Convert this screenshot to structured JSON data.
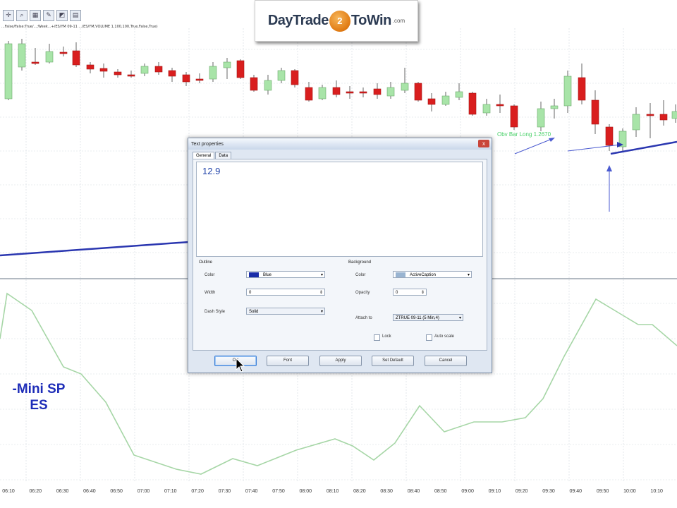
{
  "logo": {
    "left": "DayTrade",
    "badge": "2",
    "right": "ToWin",
    "com": ".com"
  },
  "chart_params": "...False/False:True/...;Week...+/ES/YM 09-11 ...(ES/YM,VOLUME 1,100,100,True,False,True)",
  "annotation_green": "Obv Bar Long 1.2670",
  "chart_label": {
    "line1": "-Mini SP",
    "line2": "ES"
  },
  "time_ticks": [
    "06:10",
    "06:20",
    "06:30",
    "06:40",
    "06:50",
    "07:00",
    "07:10",
    "07:20",
    "07:30",
    "07:40",
    "07:50",
    "08:00",
    "08:10",
    "08:20",
    "08:30",
    "08:40",
    "08:50",
    "09:00",
    "09:10",
    "09:20",
    "09:30",
    "09:40",
    "09:50",
    "10:00",
    "10:10"
  ],
  "dialog": {
    "title": "Text properties",
    "close": "x",
    "tabs": [
      "General",
      "Data"
    ],
    "text_value": "12.9",
    "outline": {
      "title": "Outline",
      "color_label": "Color",
      "color_value": "Blue",
      "color_hex": "#1a2da8",
      "width_label": "Width",
      "width_value": "0",
      "dash_label": "Dash Style",
      "dash_value": "Solid"
    },
    "background": {
      "title": "Background",
      "color_label": "Color",
      "color_value": "ActiveCaption",
      "color_hex": "#99b4d1",
      "opacity_label": "Opacity",
      "opacity_value": "0",
      "attach_label": "Attach to",
      "attach_value": "ZTRUE 09-11 (5 Min,4)",
      "lock_label": "Lock",
      "autoscale_label": "Auto scale"
    },
    "buttons": {
      "ok": "OK",
      "font": "Font",
      "apply": "Apply",
      "default": "Set Default",
      "cancel": "Cancel"
    }
  },
  "colors": {
    "up_candle": "#a8e4a8",
    "down_candle": "#d91e1e",
    "trend_line": "#2a36b0",
    "oscillator": "#a6d6a6"
  }
}
